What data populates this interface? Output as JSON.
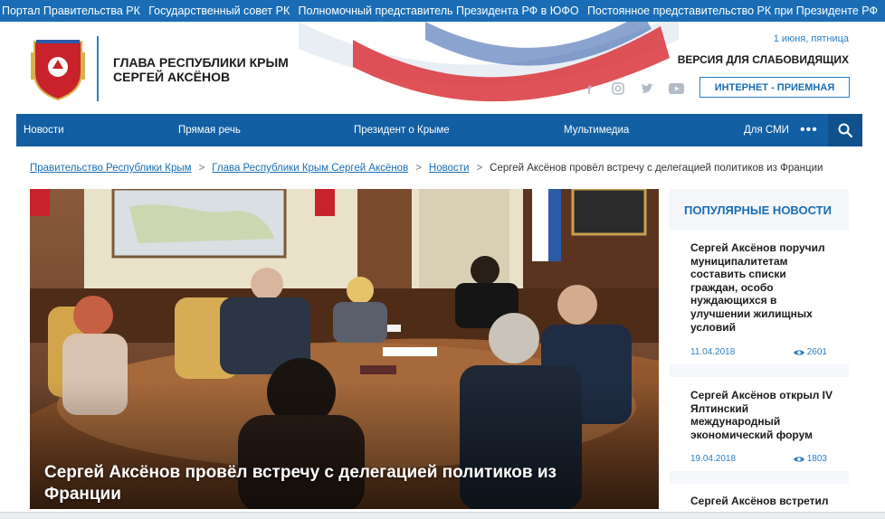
{
  "top_links": [
    "Портал Правительства РК",
    "Государственный совет РК",
    "Полномочный представитель Президента РФ в ЮФО",
    "Постоянное представительство РК при Президенте РФ"
  ],
  "header": {
    "title_line1": "ГЛАВА РЕСПУБЛИКИ КРЫМ",
    "title_line2": "СЕРГЕЙ АКСЁНОВ",
    "date": "1 июня, пятница",
    "low_vision": "ВЕРСИЯ ДЛЯ СЛАБОВИДЯЩИХ",
    "reception": "ИНТЕРНЕТ - ПРИЕМНАЯ",
    "socials": [
      "facebook-icon",
      "instagram-icon",
      "twitter-icon",
      "youtube-icon"
    ]
  },
  "nav": {
    "items": [
      "Новости",
      "Прямая речь",
      "Президент о Крыме",
      "Мультимедиа",
      "Для СМИ"
    ],
    "more": "•••"
  },
  "breadcrumb": {
    "links": [
      "Правительство Республики Крым",
      "Глава Республики Крым Сергей Аксёнов",
      "Новости"
    ],
    "current": "Сергей Аксёнов провёл встречу с делегацией политиков из Франции",
    "separator": ">"
  },
  "main": {
    "caption": "Сергей Аксёнов провёл встречу с делегацией политиков из Франции"
  },
  "sidebar": {
    "title": "ПОПУЛЯРНЫЕ НОВОСТИ",
    "news": [
      {
        "title": "Сергей Аксёнов поручил муниципалитетам составить списки граждан, особо нуждающихся в улучшении жилищных условий",
        "date": "11.04.2018",
        "views": "2601"
      },
      {
        "title": "Сергей Аксёнов открыл IV Ялтинский международный экономический форум",
        "date": "19.04.2018",
        "views": "1803"
      },
      {
        "title": "Сергей Аксёнов встретил",
        "date": "",
        "views": ""
      }
    ]
  },
  "colors": {
    "accent": "#1a6db4",
    "nav": "#135fa3",
    "topbar": "#1a6db4"
  }
}
